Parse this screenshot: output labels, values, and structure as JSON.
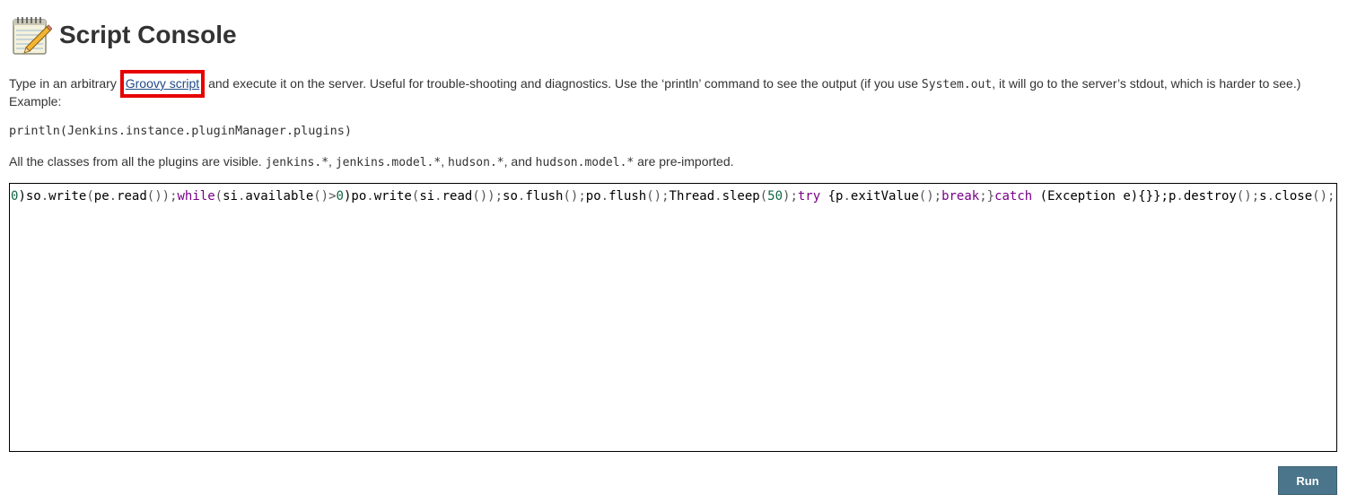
{
  "header": {
    "title": "Script Console",
    "icon": "notepad-icon"
  },
  "description": {
    "part1": "Type in an arbitrary ",
    "link_text": "Groovy script",
    "part2": " and execute it on the server. Useful for trouble-shooting and diagnostics. Use the ‘println’ command to see the output (if you use ",
    "code_system_out": "System.out",
    "part3": ", it will go to the server’s stdout, which is harder to see.) Example:"
  },
  "example": "println(Jenkins.instance.pluginManager.plugins)",
  "visible_note": {
    "part1": "All the classes from all the plugins are visible. ",
    "code1": "jenkins.*",
    "sep1": ", ",
    "code2": "jenkins.model.*",
    "sep2": ", ",
    "code3": "hudson.*",
    "sep3": ", and ",
    "code4": "hudson.model.*",
    "part2": " are pre-imported."
  },
  "editor": {
    "tokens": [
      {
        "t": "0",
        "c": "num"
      },
      {
        "t": ")so",
        "c": ""
      },
      {
        "t": ".",
        "c": "op"
      },
      {
        "t": "write",
        "c": ""
      },
      {
        "t": "(",
        "c": "op"
      },
      {
        "t": "pe",
        "c": ""
      },
      {
        "t": ".",
        "c": "op"
      },
      {
        "t": "read",
        "c": ""
      },
      {
        "t": "());",
        "c": "op"
      },
      {
        "t": "while",
        "c": "kw"
      },
      {
        "t": "(",
        "c": "op"
      },
      {
        "t": "si",
        "c": ""
      },
      {
        "t": ".",
        "c": "op"
      },
      {
        "t": "available",
        "c": ""
      },
      {
        "t": "()>",
        "c": "op"
      },
      {
        "t": "0",
        "c": "num"
      },
      {
        "t": ")po",
        "c": ""
      },
      {
        "t": ".",
        "c": "op"
      },
      {
        "t": "write",
        "c": ""
      },
      {
        "t": "(",
        "c": "op"
      },
      {
        "t": "si",
        "c": ""
      },
      {
        "t": ".",
        "c": "op"
      },
      {
        "t": "read",
        "c": ""
      },
      {
        "t": "());",
        "c": "op"
      },
      {
        "t": "so",
        "c": ""
      },
      {
        "t": ".",
        "c": "op"
      },
      {
        "t": "flush",
        "c": ""
      },
      {
        "t": "();",
        "c": "op"
      },
      {
        "t": "po",
        "c": ""
      },
      {
        "t": ".",
        "c": "op"
      },
      {
        "t": "flush",
        "c": ""
      },
      {
        "t": "();",
        "c": "op"
      },
      {
        "t": "Thread",
        "c": ""
      },
      {
        "t": ".",
        "c": "op"
      },
      {
        "t": "sleep",
        "c": ""
      },
      {
        "t": "(",
        "c": "op"
      },
      {
        "t": "50",
        "c": "num"
      },
      {
        "t": ");",
        "c": "op"
      },
      {
        "t": "try",
        "c": "kw"
      },
      {
        "t": " {",
        "c": ""
      },
      {
        "t": "p",
        "c": ""
      },
      {
        "t": ".",
        "c": "op"
      },
      {
        "t": "exitValue",
        "c": ""
      },
      {
        "t": "();",
        "c": "op"
      },
      {
        "t": "break",
        "c": "kw"
      },
      {
        "t": ";}",
        "c": "op"
      },
      {
        "t": "catch",
        "c": "kw"
      },
      {
        "t": " (Exception e){}};",
        "c": ""
      },
      {
        "t": "p",
        "c": ""
      },
      {
        "t": ".",
        "c": "op"
      },
      {
        "t": "destroy",
        "c": ""
      },
      {
        "t": "();",
        "c": "op"
      },
      {
        "t": "s",
        "c": ""
      },
      {
        "t": ".",
        "c": "op"
      },
      {
        "t": "close",
        "c": ""
      },
      {
        "t": "();",
        "c": "op"
      }
    ]
  },
  "run_button": {
    "label": "Run"
  },
  "colors": {
    "link": "#204a87",
    "highlight_box": "#e60000",
    "run_button_bg": "#4b758b",
    "keyword": "#770088",
    "number": "#116644"
  }
}
